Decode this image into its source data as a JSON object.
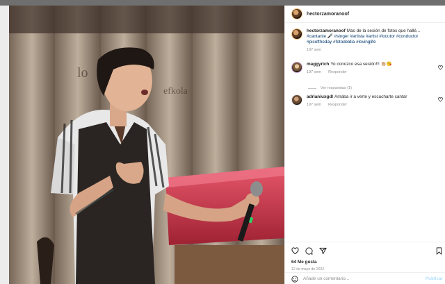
{
  "post": {
    "username": "hectorzamoranoof",
    "caption_user": "hectorzamoranoof",
    "caption_text": "Mas de la sesión de fotos que hallé...",
    "caption_tags": [
      "#cantante 🎤",
      "#singer",
      "#artista",
      "#artist",
      "#locutor",
      "#conductor",
      "#picoftheday",
      "#fotodeldia",
      "#lovinglife"
    ],
    "caption_time": "197 sem",
    "likes": "64 Me gusta",
    "date": "12 de mayo de 2022"
  },
  "comments": [
    {
      "user": "maggyrich",
      "text": "Yo conozco esa sesión!!! 👏🏼😘",
      "time": "197 sem",
      "reply": "Responder"
    },
    {
      "user": "adrianiuxgdl",
      "text": "Amaba ir a verte y escucharte cantar",
      "time": "197 sem",
      "reply": "Responder"
    }
  ],
  "replies_label": "Ver respuestas (1)",
  "add_comment": {
    "placeholder": "Añade un comentario...",
    "post_label": "Publicar"
  },
  "icons": [
    "heart-icon",
    "comment-icon",
    "share-icon",
    "bookmark-icon",
    "emoji-icon"
  ]
}
